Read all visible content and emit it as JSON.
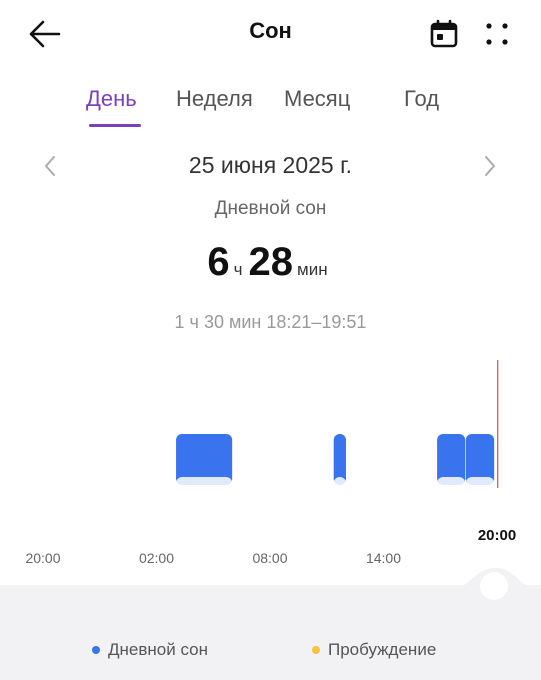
{
  "header": {
    "title": "Сон",
    "back_icon": "arrow-left-icon",
    "calendar_icon": "calendar-icon",
    "more_icon": "four-dots-icon"
  },
  "tabs": [
    {
      "label": "День",
      "active": true
    },
    {
      "label": "Неделя",
      "active": false
    },
    {
      "label": "Месяц",
      "active": false
    },
    {
      "label": "Год",
      "active": false
    }
  ],
  "date": {
    "label": "25 июня 2025 г."
  },
  "summary": {
    "sleep_type": "Дневной сон",
    "hours": "6",
    "hours_unit": "ч",
    "minutes": "28",
    "minutes_unit": "мин",
    "selected_segment": "1 ч 30 мин 18:21–19:51"
  },
  "chart_data": {
    "type": "timeline",
    "x_ticks": [
      "20:00",
      "02:00",
      "08:00",
      "14:00",
      "20:00"
    ],
    "x_range_hours": [
      0,
      24
    ],
    "segments": [
      {
        "start": "03:02",
        "end": "06:00",
        "state": "Дневной сон"
      },
      {
        "start": "11:22",
        "end": "12:01",
        "state": "Дневной сон"
      },
      {
        "start": "16:50",
        "end": "18:19",
        "state": "Дневной сон"
      },
      {
        "start": "18:21",
        "end": "19:51",
        "state": "Дневной сон"
      }
    ],
    "current_time_marker": "19:59",
    "highlighted_tick": "20:00",
    "colors": {
      "sleep": "#3a73ee",
      "awake": "#f5c242",
      "marker": "#e8455a"
    }
  },
  "legend": [
    {
      "label": "Дневной сон",
      "color": "#3a73ee"
    },
    {
      "label": "Пробуждение",
      "color": "#f5c242"
    }
  ]
}
